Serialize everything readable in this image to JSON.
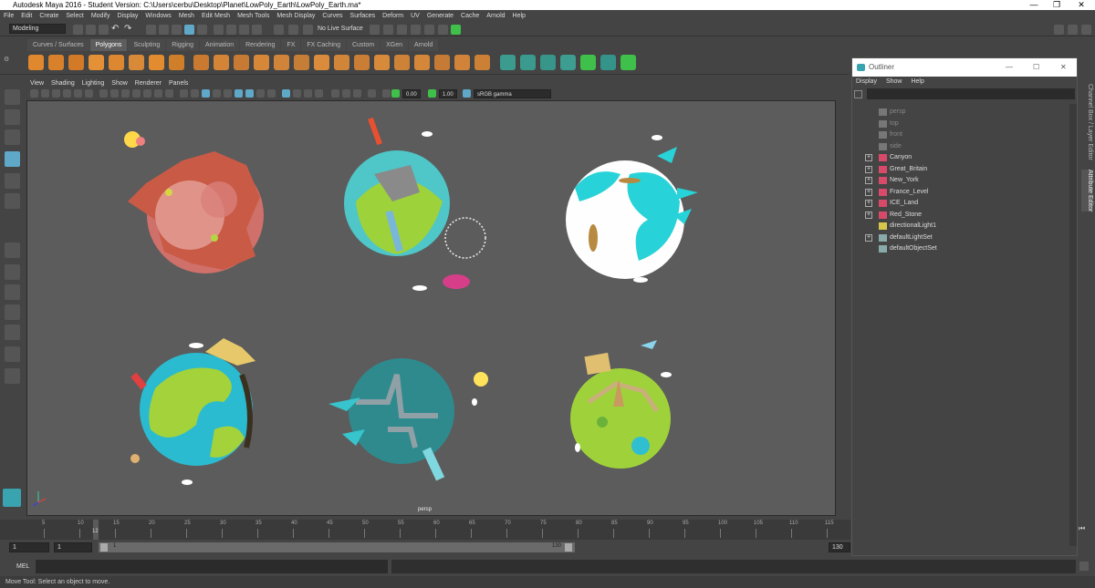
{
  "window": {
    "title": "Autodesk Maya 2016 - Student Version: C:\\Users\\cerbu\\Desktop\\Planet\\LowPoly_Earth\\LowPoly_Earth.ma*",
    "min": "—",
    "max": "❐",
    "close": "✕"
  },
  "menu": [
    "File",
    "Edit",
    "Create",
    "Select",
    "Modify",
    "Display",
    "Windows",
    "Mesh",
    "Edit Mesh",
    "Mesh Tools",
    "Mesh Display",
    "Curves",
    "Surfaces",
    "Deform",
    "UV",
    "Generate",
    "Cache",
    "Arnold",
    "Help"
  ],
  "status": {
    "mode": "Modeling",
    "live_surface": "No Live Surface"
  },
  "shelf_tabs": [
    "Curves / Surfaces",
    "Polygons",
    "Sculpting",
    "Rigging",
    "Animation",
    "Rendering",
    "FX",
    "FX Caching",
    "Custom",
    "XGen",
    "Arnold"
  ],
  "shelf_active": "Polygons",
  "panel_menu": [
    "View",
    "Shading",
    "Lighting",
    "Show",
    "Renderer",
    "Panels"
  ],
  "panel_values": {
    "near": "0.00",
    "far": "1.00",
    "colorspace": "sRGB gamma"
  },
  "viewport": {
    "camera": "persp"
  },
  "outliner": {
    "title": "Outliner",
    "menu": [
      "Display",
      "Show",
      "Help"
    ],
    "items": [
      {
        "label": "persp",
        "kind": "camera",
        "expand": false,
        "dim": true
      },
      {
        "label": "top",
        "kind": "camera",
        "expand": false,
        "dim": true
      },
      {
        "label": "front",
        "kind": "camera",
        "expand": false,
        "dim": true
      },
      {
        "label": "side",
        "kind": "camera",
        "expand": false,
        "dim": true
      },
      {
        "label": "Canyon",
        "kind": "mesh",
        "expand": true,
        "dim": false
      },
      {
        "label": "Great_Britain",
        "kind": "mesh",
        "expand": true,
        "dim": false
      },
      {
        "label": "New_York",
        "kind": "mesh",
        "expand": true,
        "dim": false
      },
      {
        "label": "France_Level",
        "kind": "mesh",
        "expand": true,
        "dim": false
      },
      {
        "label": "ICE_Land",
        "kind": "mesh",
        "expand": true,
        "dim": false
      },
      {
        "label": "Red_Stone",
        "kind": "mesh",
        "expand": true,
        "dim": false
      },
      {
        "label": "directionalLight1",
        "kind": "light",
        "expand": false,
        "dim": false
      },
      {
        "label": "defaultLightSet",
        "kind": "set",
        "expand": true,
        "dim": false
      },
      {
        "label": "defaultObjectSet",
        "kind": "set",
        "expand": false,
        "dim": false
      }
    ]
  },
  "side_tabs": [
    "Channel Box / Layer Editor",
    "Attribute Editor"
  ],
  "timeline": {
    "ticks": [
      "5",
      "10",
      "15",
      "20",
      "25",
      "30",
      "35",
      "40",
      "45",
      "50",
      "55",
      "60",
      "65",
      "70",
      "75",
      "80",
      "85",
      "90",
      "95",
      "100",
      "105",
      "110",
      "115"
    ],
    "current": "12"
  },
  "range": {
    "start": "1",
    "start_inner": "1",
    "range_start": "1",
    "range_end": "130",
    "end": "130"
  },
  "cmdline": {
    "label": "MEL"
  },
  "help": "Move Tool: Select an object to move.",
  "colors": {
    "accent": "#5fa8c8",
    "highlight": "#69c7ff",
    "green": "#3fc04a"
  }
}
